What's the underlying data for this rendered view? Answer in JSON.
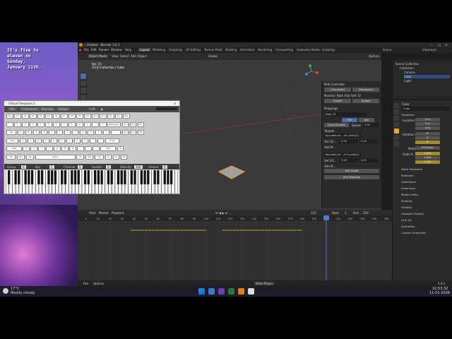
{
  "desktop": {
    "wallpaper_lines": [
      "It's five to",
      "eleven on",
      "Sunday,",
      "January 11th."
    ]
  },
  "blender": {
    "title": "• Untitled - Blender 5.0.1",
    "menus": [
      "File",
      "Edit",
      "Render",
      "Window",
      "Help"
    ],
    "workspaces": [
      "Layout",
      "Modeling",
      "Sculpting",
      "UV Editing",
      "Texture Paint",
      "Shading",
      "Animation",
      "Rendering",
      "Compositing",
      "Geometry Nodes",
      "Scripting"
    ],
    "active_workspace": "Layout",
    "scene": "Scene",
    "view_layer": "ViewLayer",
    "viewport_header": {
      "mode": "Object Mode",
      "items": [
        "View",
        "Select",
        "Add",
        "Object"
      ],
      "transform": "Global",
      "options": "Options"
    },
    "viewport_info": [
      "fps: 25",
      "(153) Collection | Cube"
    ],
    "midi_panel": {
      "title": "Midi Controller",
      "connect": "Connected",
      "disconnect": "Disconnect",
      "monitor": "Monitor: Note A5b (Vel: 0)",
      "export": "Export",
      "import": "Import",
      "mappings": "Mappings",
      "note": "Note 74",
      "flags": [
        "Rel",
        "Abs"
      ],
      "quad": "Quad Smooth",
      "speed_label": "Speed",
      "speed_value": "0.05",
      "targets_label": "Targets",
      "targets": [
        {
          "path": "bpy.data.ob....ion_euler[2]",
          "set_label": "Set (0)...",
          "v1": "0.00",
          "v2": "0.00"
        },
        {
          "path": "bpy.data.ob....el\"].scale[0]",
          "set_label": "Set (0)...",
          "v1": "0.00",
          "v2": "0.00"
        }
      ],
      "add_labels": [
        "Add M...",
        "Add M...",
        "Add M..."
      ],
      "add_target": "Add Target",
      "new_mapping": "New Mapping"
    },
    "outliner": {
      "title": "Scene Collection",
      "items": [
        "Collection",
        "Camera",
        "Cube",
        "Light"
      ]
    },
    "properties": {
      "object_name": "Cube",
      "data_name": "Cube",
      "transform": "Transform",
      "location_label": "Location X",
      "location": [
        "0 m",
        "0 m",
        "0 m"
      ],
      "rotation_label": "Rotation X",
      "rotation": [
        "0°",
        "0°",
        "0°"
      ],
      "mode_label": "Mode",
      "mode": "XYZ Euler",
      "scale_label": "Scale X",
      "scale": [
        "1.000",
        "1.000",
        "1.000"
      ],
      "axis_labels": [
        "Y",
        "Z"
      ],
      "sections": [
        "Delta Transform",
        "Relations",
        "Collections",
        "Instancing",
        "Motion Paths",
        "Shading",
        "Visibility",
        "Viewport Display",
        "Line Art",
        "Animation",
        "Custom Properties"
      ]
    },
    "timeline": {
      "menus": [
        "View",
        "Marker",
        "Playback"
      ],
      "current_frame": "153",
      "start_label": "Start",
      "start": "1",
      "end_label": "End",
      "end": "250",
      "ticks": [
        "0",
        "10",
        "20",
        "30",
        "40",
        "50",
        "60",
        "70",
        "80",
        "90",
        "100",
        "110",
        "120",
        "130",
        "140",
        "150",
        "160",
        "170",
        "180",
        "190",
        "200",
        "210",
        "220",
        "230",
        "240",
        "250"
      ]
    },
    "statusbar": {
      "left": [
        "Pan",
        "Options"
      ],
      "center": "Write Player",
      "version": "5.0.1"
    }
  },
  "piano": {
    "title": "Virtual Freepiano 2",
    "toolbar": [
      "File",
      "Instrument",
      "Keymap",
      "Global"
    ],
    "tempo": "0.00",
    "keyboard_rows": [
      [
        "Esc",
        "F1",
        "F2",
        "F3",
        "F4",
        "F5",
        "F6",
        "F7",
        "F8",
        "F9",
        "F10",
        "F11",
        "F12",
        "Prt",
        "Scr",
        "Pse"
      ],
      [
        "`",
        "1",
        "2",
        "3",
        "4",
        "5",
        "6",
        "7",
        "8",
        "9",
        "0",
        "-",
        "=",
        "Backspace",
        "Ins",
        "Hm",
        "PU"
      ],
      [
        "Tab",
        "Q",
        "W",
        "E",
        "R",
        "T",
        "Y",
        "U",
        "I",
        "O",
        "P",
        "[",
        "]",
        "\\",
        "Del",
        "End",
        "PD"
      ],
      [
        "Caps",
        "A",
        "S",
        "D",
        "F",
        "G",
        "H",
        "J",
        "K",
        "L",
        ";",
        "'",
        "Enter"
      ],
      [
        "Shift",
        "Z",
        "X",
        "C",
        "V",
        "B",
        "N",
        "M",
        ",",
        ".",
        "/",
        "Shift",
        "Up"
      ],
      [
        "Ctrl",
        "Win",
        "Alt",
        "Space",
        "Alt",
        "Win",
        "Ctrl",
        "Lt",
        "Dn",
        "Rt"
      ]
    ],
    "controls": [
      {
        "label": "Group",
        "value": "0"
      },
      {
        "label": "Key",
        "value": "C"
      },
      {
        "label": "Channel",
        "value": "0"
      },
      {
        "label": "Sustain",
        "value": "0"
      },
      {
        "label": "Velocity",
        "value": "100"
      },
      {
        "label": "Octave",
        "value": "0"
      }
    ]
  },
  "taskbar": {
    "weather_temp": "17°C",
    "weather_text": "Mostly cloudy",
    "time": "10:53:32",
    "date": "11-01-2026"
  },
  "colors": {
    "blender_bg": "#1d1d1d",
    "accent_orange": "#e8a33c",
    "selection_blue": "#334d80",
    "keyframe_yellow": "#e0c040",
    "playhead_blue": "#4a7dd4"
  }
}
